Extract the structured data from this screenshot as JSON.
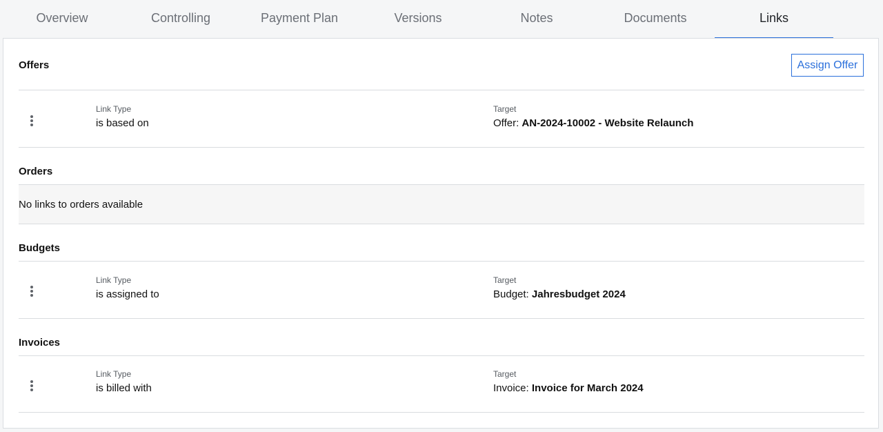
{
  "tabs": [
    {
      "label": "Overview"
    },
    {
      "label": "Controlling"
    },
    {
      "label": "Payment Plan"
    },
    {
      "label": "Versions"
    },
    {
      "label": "Notes"
    },
    {
      "label": "Documents"
    },
    {
      "label": "Links",
      "active": true
    }
  ],
  "accent_color": "#2a6fdb",
  "offers": {
    "title": "Offers",
    "assign_button": "Assign Offer",
    "row": {
      "link_type_label": "Link Type",
      "link_type": "is based on",
      "target_label": "Target",
      "target_prefix": "Offer:",
      "target_name": "AN-2024-10002 - Website Relaunch"
    }
  },
  "orders": {
    "title": "Orders",
    "empty_text": "No links to orders available"
  },
  "budgets": {
    "title": "Budgets",
    "row": {
      "link_type_label": "Link Type",
      "link_type": "is assigned to",
      "target_label": "Target",
      "target_prefix": "Budget:",
      "target_name": "Jahresbudget 2024"
    }
  },
  "invoices": {
    "title": "Invoices",
    "row": {
      "link_type_label": "Link Type",
      "link_type": "is billed with",
      "target_label": "Target",
      "target_prefix": "Invoice:",
      "target_name": "Invoice for March 2024"
    }
  },
  "icons": {
    "row_menu": "vertical-dots-icon"
  }
}
